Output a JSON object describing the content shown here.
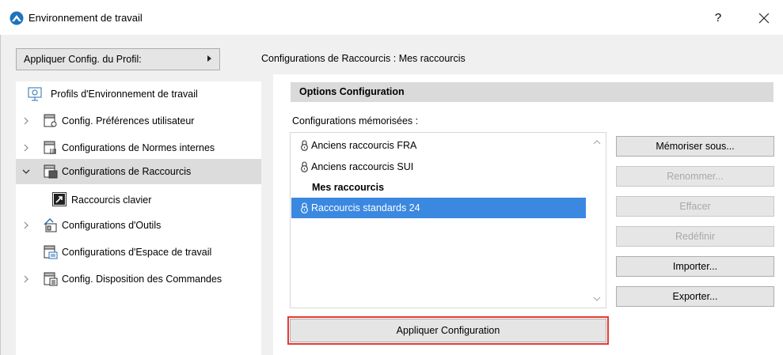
{
  "window": {
    "title": "Environnement de travail",
    "help_label": "?",
    "accent": "#1e73be"
  },
  "profile_button": {
    "label": "Appliquer Config. du Profil:"
  },
  "config_title": "Configurations de Raccourcis : Mes raccourcis",
  "tree": {
    "items": [
      {
        "label": "Profils d'Environnement de travail",
        "icon": "profiles-icon",
        "expander": "none",
        "selected": false
      },
      {
        "label": "Config. Préférences utilisateur",
        "icon": "user-preferences-icon",
        "expander": "collapsed",
        "selected": false
      },
      {
        "label": "Configurations de Normes  internes",
        "icon": "company-standards-icon",
        "expander": "collapsed",
        "selected": false
      },
      {
        "label": "Configurations de Raccourcis",
        "icon": "shortcuts-config-icon",
        "expander": "expanded",
        "selected": true
      },
      {
        "label": "Raccourcis clavier",
        "icon": "keyboard-shortcut-icon",
        "expander": "child",
        "selected": false
      },
      {
        "label": "Configurations d'Outils",
        "icon": "tools-icon",
        "expander": "collapsed",
        "selected": false
      },
      {
        "label": "Configurations d'Espace de travail",
        "icon": "workspace-icon",
        "expander": "none",
        "selected": false
      },
      {
        "label": "Config. Disposition des Commandes",
        "icon": "command-layout-icon",
        "expander": "collapsed",
        "selected": false
      }
    ]
  },
  "options": {
    "header": "Options Configuration",
    "saved_label": "Configurations mémorisées :",
    "list": [
      {
        "label": "Anciens raccourcis FRA",
        "locked": true,
        "bold": false,
        "selected": false
      },
      {
        "label": "Anciens raccourcis SUI",
        "locked": true,
        "bold": false,
        "selected": false
      },
      {
        "label": "Mes raccourcis",
        "locked": false,
        "bold": true,
        "selected": false
      },
      {
        "label": "Raccourcis standards 24",
        "locked": true,
        "bold": false,
        "selected": true
      }
    ],
    "selection_color": "#3b88e0"
  },
  "buttons": {
    "save_as": "Mémoriser sous...",
    "rename": "Renommer...",
    "delete": "Effacer",
    "redefine": "Redéfinir",
    "import": "Importer...",
    "export": "Exporter..."
  },
  "apply_button": {
    "label": "Appliquer Configuration",
    "highlight_color": "#e53935"
  }
}
